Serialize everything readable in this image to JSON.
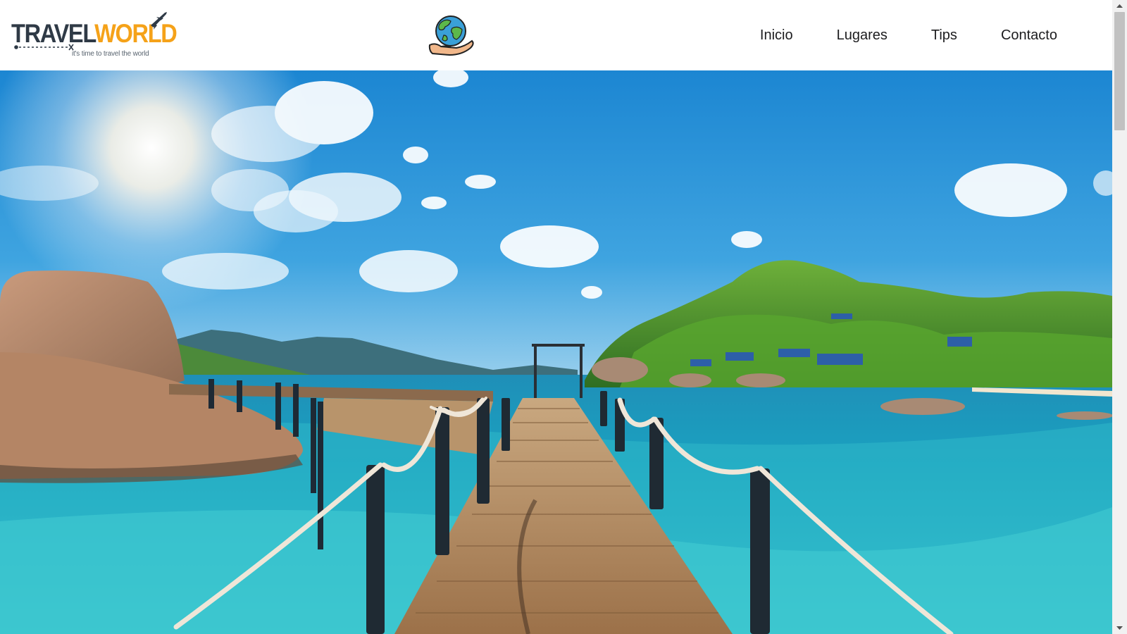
{
  "header": {
    "logo": {
      "word_travel": "TRAVEL",
      "word_world": "WORLD",
      "tagline": "it's time to travel the world",
      "icon": "plane-icon"
    },
    "center_icon": "globe-in-hand-icon",
    "nav": [
      {
        "label": "Inicio"
      },
      {
        "label": "Lugares"
      },
      {
        "label": "Tips"
      },
      {
        "label": "Contacto"
      }
    ]
  },
  "hero": {
    "image": "tropical-pier-photo",
    "description_colors": {
      "sky": "#1e8fd6",
      "sea": "#2fb6c9",
      "wood": "#b58a5c",
      "rock": "#b88c6f",
      "island": "#4f9a2c"
    }
  },
  "colors": {
    "brand_dark": "#2f3a46",
    "brand_orange": "#f5a219",
    "nav_text": "#1d1d1f",
    "header_bg": "#ffffff"
  }
}
